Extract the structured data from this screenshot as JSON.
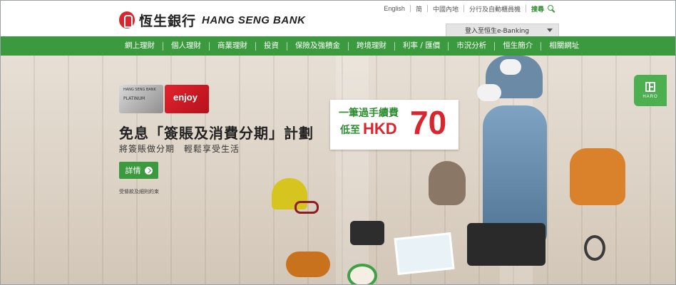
{
  "brand": {
    "name_cn": "恆生銀行",
    "name_en": "HANG SENG BANK"
  },
  "toplinks": {
    "english": "English",
    "simplified": "简",
    "mainland": "中國內地",
    "branches": "分行及自動櫃員機",
    "search": "搜尋"
  },
  "login": {
    "label": "登入至恒生e-Banking"
  },
  "nav": {
    "items": [
      "網上理財",
      "個人理財",
      "商業理財",
      "投資",
      "保險及強積金",
      "跨境理財",
      "利率 / 匯價",
      "市況分析",
      "恒生簡介",
      "相關網址"
    ]
  },
  "hero": {
    "headline": "免息「簽賬及消費分期」計劃",
    "subline": "將簽賬做分期　輕鬆享受生活",
    "detail_button": "詳情",
    "terms": "受條款及細則約束",
    "card_silver_text": "HANG SENG BANK",
    "card_silver_tier": "PLATINUM",
    "card_red_text": "enjoy",
    "fee_line1": "一筆過手續費",
    "fee_prefix": "低至",
    "fee_currency": "HKD",
    "fee_amount": "70"
  },
  "haro": {
    "label": "HARO"
  },
  "colors": {
    "brand_green": "#3b9a3e",
    "brand_red": "#d8262e",
    "fee_green": "#2e8f32"
  }
}
